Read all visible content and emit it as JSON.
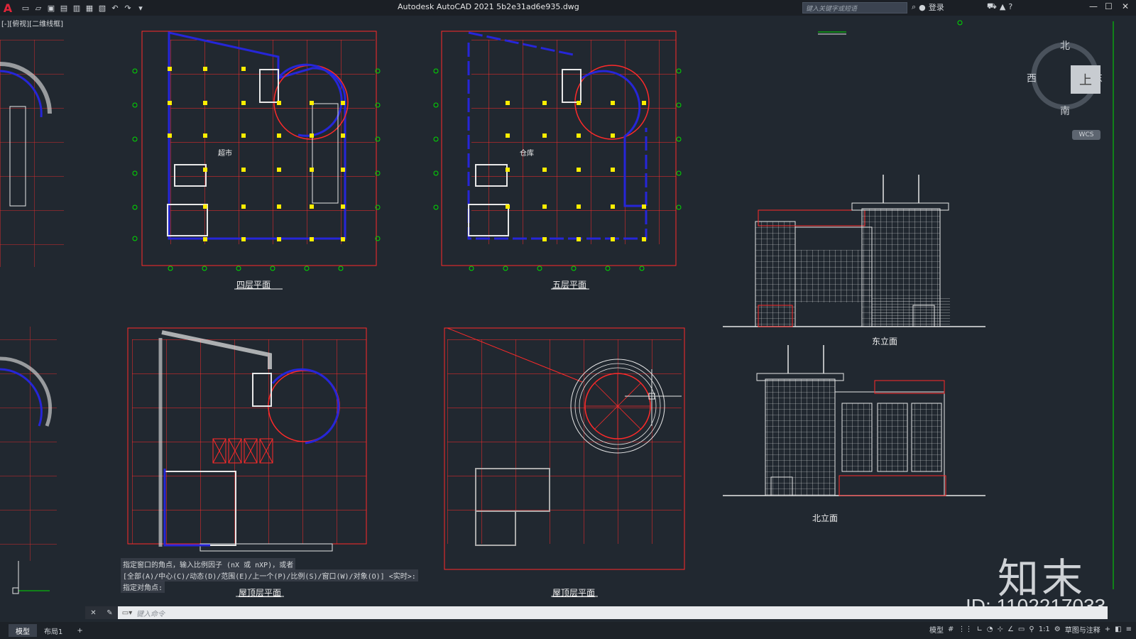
{
  "app": {
    "logo": "A",
    "title": "Autodesk AutoCAD 2021    5b2e31ad6e935.dwg",
    "search_placeholder": "键入关键字或短语",
    "login": "登录",
    "accent": "#e0263a"
  },
  "viewport": {
    "label": "[-][俯视][二维线框]"
  },
  "drawing": {
    "plan_labels": {
      "floor4": "四层平面",
      "floor5": "五层平面",
      "roof1": "屋顶层平面",
      "roof2": "屋顶层平面"
    },
    "room_labels": {
      "supermarket": "超市",
      "warehouse": "仓库"
    },
    "elevation_labels": {
      "east": "东立面",
      "north": "北立面"
    },
    "colors": {
      "grid": "#ff2a2a",
      "wall": "#2626d8",
      "column": "#ffee00",
      "axis_bubble": "#00dd00",
      "line": "#f0f0f0",
      "background": "#212830"
    }
  },
  "viewcube": {
    "north": "北",
    "south": "南",
    "east": "东",
    "west": "西",
    "top": "上",
    "wcs": "WCS"
  },
  "command": {
    "history": [
      "指定窗口的角点，输入比例因子 (nX 或 nXP)，或者",
      "[全部(A)/中心(C)/动态(D)/范围(E)/上一个(P)/比例(S)/窗口(W)/对象(O)] <实时>:",
      "指定对角点:"
    ],
    "placeholder": "键入命令"
  },
  "status": {
    "tabs": [
      "模型",
      "布局1"
    ],
    "add_tab": "+",
    "model": "模型",
    "scale": "1:1",
    "workspace": "草图与注释"
  },
  "watermark": {
    "brand": "知末",
    "id": "ID: 1102217033"
  }
}
